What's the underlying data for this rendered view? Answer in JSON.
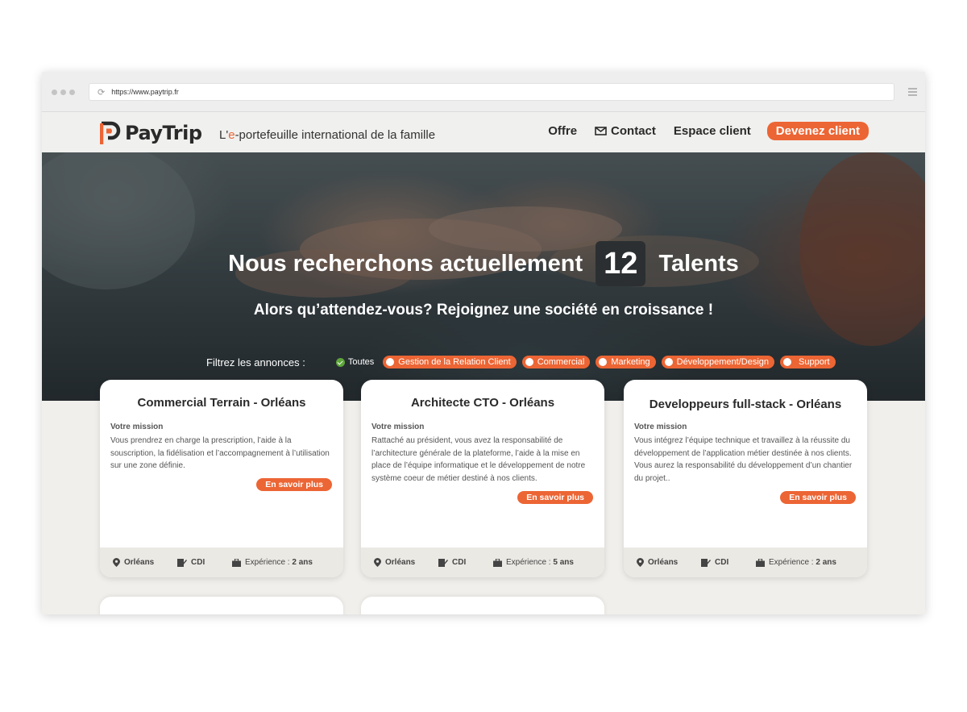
{
  "browser": {
    "url": "https://www.paytrip.fr"
  },
  "header": {
    "logo_text": "PayTrip",
    "tagline_prefix": "L'",
    "tagline_accent": "e",
    "tagline_rest": "-portefeuille international de la famille",
    "nav": {
      "offre": "Offre",
      "contact": "Contact",
      "espace_client": "Espace client",
      "cta": "Devenez client"
    }
  },
  "hero": {
    "headline_before": "Nous recherchons actuellement",
    "count": "12",
    "headline_after": "Talents",
    "subline": "Alors qu’attendez-vous? Rejoignez une société en croissance !",
    "filter_label": "Filtrez les annonces :",
    "filters": [
      "Toutes",
      "Gestion de la Relation Client",
      "Commercial",
      "Marketing",
      "Développement/Design",
      "Support"
    ]
  },
  "jobs": [
    {
      "title": "Commercial Terrain - Orléans",
      "mission_label": "Votre mission",
      "mission": "Vous prendrez en charge la prescription, l’aide à la souscription, la fidélisation et l’accompagnement à l’utilisation sur une zone définie.",
      "more": "En savoir plus",
      "location": "Orléans",
      "contract": "CDI",
      "experience_label": "Expérience :",
      "experience": "2 ans"
    },
    {
      "title": "Architecte CTO - Orléans",
      "mission_label": "Votre mission",
      "mission": "Rattaché au président, vous avez la responsabilité de l’architecture générale de la plateforme, l’aide à la mise en place de l’équipe informatique et le développement de notre système coeur de métier destiné à nos clients.",
      "more": "En savoir plus",
      "location": "Orléans",
      "contract": "CDI",
      "experience_label": "Expérience :",
      "experience": "5 ans"
    },
    {
      "title": "Developpeurs full-stack - Orléans",
      "mission_label": "Votre mission",
      "mission": "Vous intégrez l’équipe technique et travaillez à la réussite du développement de l’application métier destinée à nos clients. Vous aurez la responsabilité du développement d’un chantier du projet..",
      "more": "En savoir plus",
      "location": "Orléans",
      "contract": "CDI",
      "experience_label": "Expérience :",
      "experience": "2 ans"
    }
  ],
  "colors": {
    "accent": "#ec6534",
    "dark": "#2a2a2a",
    "page_bg": "#f1efeb"
  }
}
